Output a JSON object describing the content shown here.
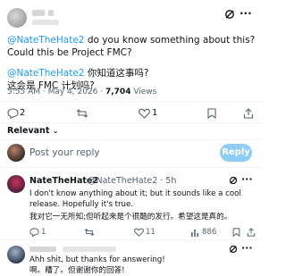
{
  "main_post": {
    "handle_blurred": true,
    "text_en_mention": "@NateTheHate2",
    "text_en_rest": " do you know something about this?",
    "text_en_line2": "Could this be Project FMC?",
    "text_zh_mention": "@NateTheHate2",
    "text_zh_rest": " 你知道这事吗?",
    "text_zh_line2": "这会是 FMC 计划吗?",
    "time": "5:55 AM · May 4, 2026 · ",
    "views_count": "7,704",
    "views_label": " Views",
    "stats": {
      "replies": "2",
      "reposts": "",
      "likes": "1"
    }
  },
  "sort_label": "Relevant",
  "reply_box": {
    "placeholder": "Post your reply",
    "button_label": "Reply"
  },
  "reply1": {
    "name": "NateTheHate2",
    "handle_time": "@NateTheHate2 · 5h",
    "text_en": "I don't know anything about it; but it sounds like a cool release. Hopefully it's true.",
    "text_zh": "我对它一无所知;但听起来是个很酷的发行。希望这是真的。",
    "stats": {
      "replies": "1",
      "reposts": "",
      "likes": "11",
      "views": "886"
    }
  },
  "reply2": {
    "text_en": "Ahh shit, but thanks for answering!",
    "text_zh": "啊。糟了。但谢谢你的回答!"
  },
  "colors": {
    "accent": "#1d9bf0",
    "muted": "#536471",
    "divider": "#eff3f4"
  }
}
